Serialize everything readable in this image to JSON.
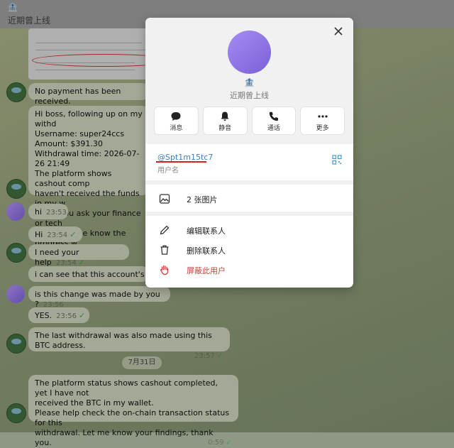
{
  "header": {
    "house_icon": "🏦",
    "title": "近期曾上线"
  },
  "messages": {
    "m1": "No payment has been received.",
    "m2_lines": [
      "Hi boss, following up on my withd",
      "Username: super24ccs",
      "Amount: $391.30",
      "Withdrawal time: 2026-07-26 21:49",
      "The platform shows cashout comp",
      "haven't received the funds in my w",
      "Could you ask your finance or tech",
      "Please let me know the progress w"
    ],
    "m3": {
      "text": "hi",
      "time": "23:53"
    },
    "m4": {
      "text": "Hi",
      "time": "23:54",
      "check": "✓"
    },
    "m5": {
      "text": "I need your help",
      "time": "23:54",
      "check": "✓"
    },
    "m6": {
      "text": "i can see that this account's BTC ad"
    },
    "m7": {
      "text": "is this change was made by you ?",
      "time": "23:56"
    },
    "m8": {
      "text": "YES.",
      "time": "23:56",
      "check": "✓"
    },
    "m9": {
      "text": "The last withdrawal was also made using this BTC address.",
      "time": "23:57",
      "check": "✓"
    },
    "date_divider": "7月31日",
    "m10_lines": [
      "The platform status shows cashout completed, yet I have not",
      "received the BTC in my wallet.",
      "Please help check the on-chain transaction status for this",
      "withdrawal. Let me know your findings, thank you."
    ],
    "m10_time": "0:59",
    "m10_check": "✓"
  },
  "popup": {
    "house_icon": "🏦",
    "status": "近期曾上线",
    "actions": [
      {
        "label": "消息",
        "icon": "message-icon"
      },
      {
        "label": "静音",
        "icon": "bell-icon"
      },
      {
        "label": "通话",
        "icon": "phone-icon"
      },
      {
        "label": "更多",
        "icon": "more-icon"
      }
    ],
    "username": "@Spt1m15tc7",
    "username_label": "用户名",
    "media": "2 张图片",
    "edit_contact": "编辑联系人",
    "delete_contact": "删除联系人",
    "block_user": "屏蔽此用户",
    "colors": {
      "link": "#3a7fc4",
      "danger": "#d63a3a",
      "underline": "#d61f1f"
    }
  }
}
